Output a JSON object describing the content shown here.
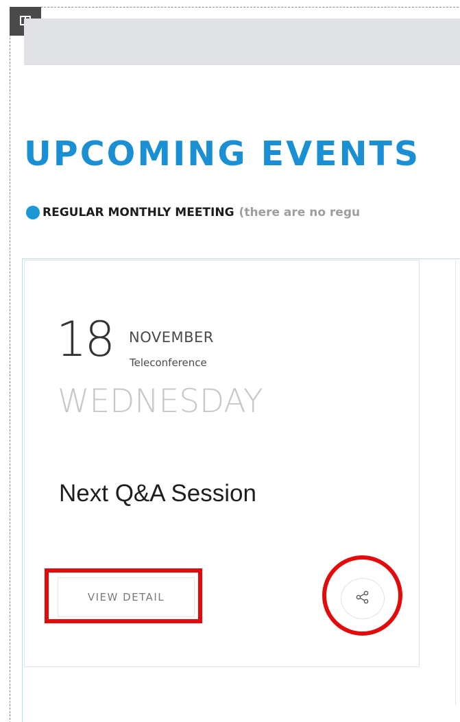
{
  "builder": {
    "column_handle_icon": "columns-icon"
  },
  "section": {
    "title": "UPCOMING EVENTS"
  },
  "legend": {
    "dot_color": "#1d97d6",
    "label": "REGULAR MONTHLY MEETING",
    "note": "(there are no regu"
  },
  "event": {
    "day": "18",
    "month": "NOVEMBER",
    "location": "Teleconference",
    "weekday": "WEDNESDAY",
    "title": "Next Q&A Session",
    "view_detail_label": "VIEW DETAIL",
    "share_icon": "share-icon"
  },
  "colors": {
    "accent": "#1a8fd4",
    "highlight": "#e20a0a"
  }
}
